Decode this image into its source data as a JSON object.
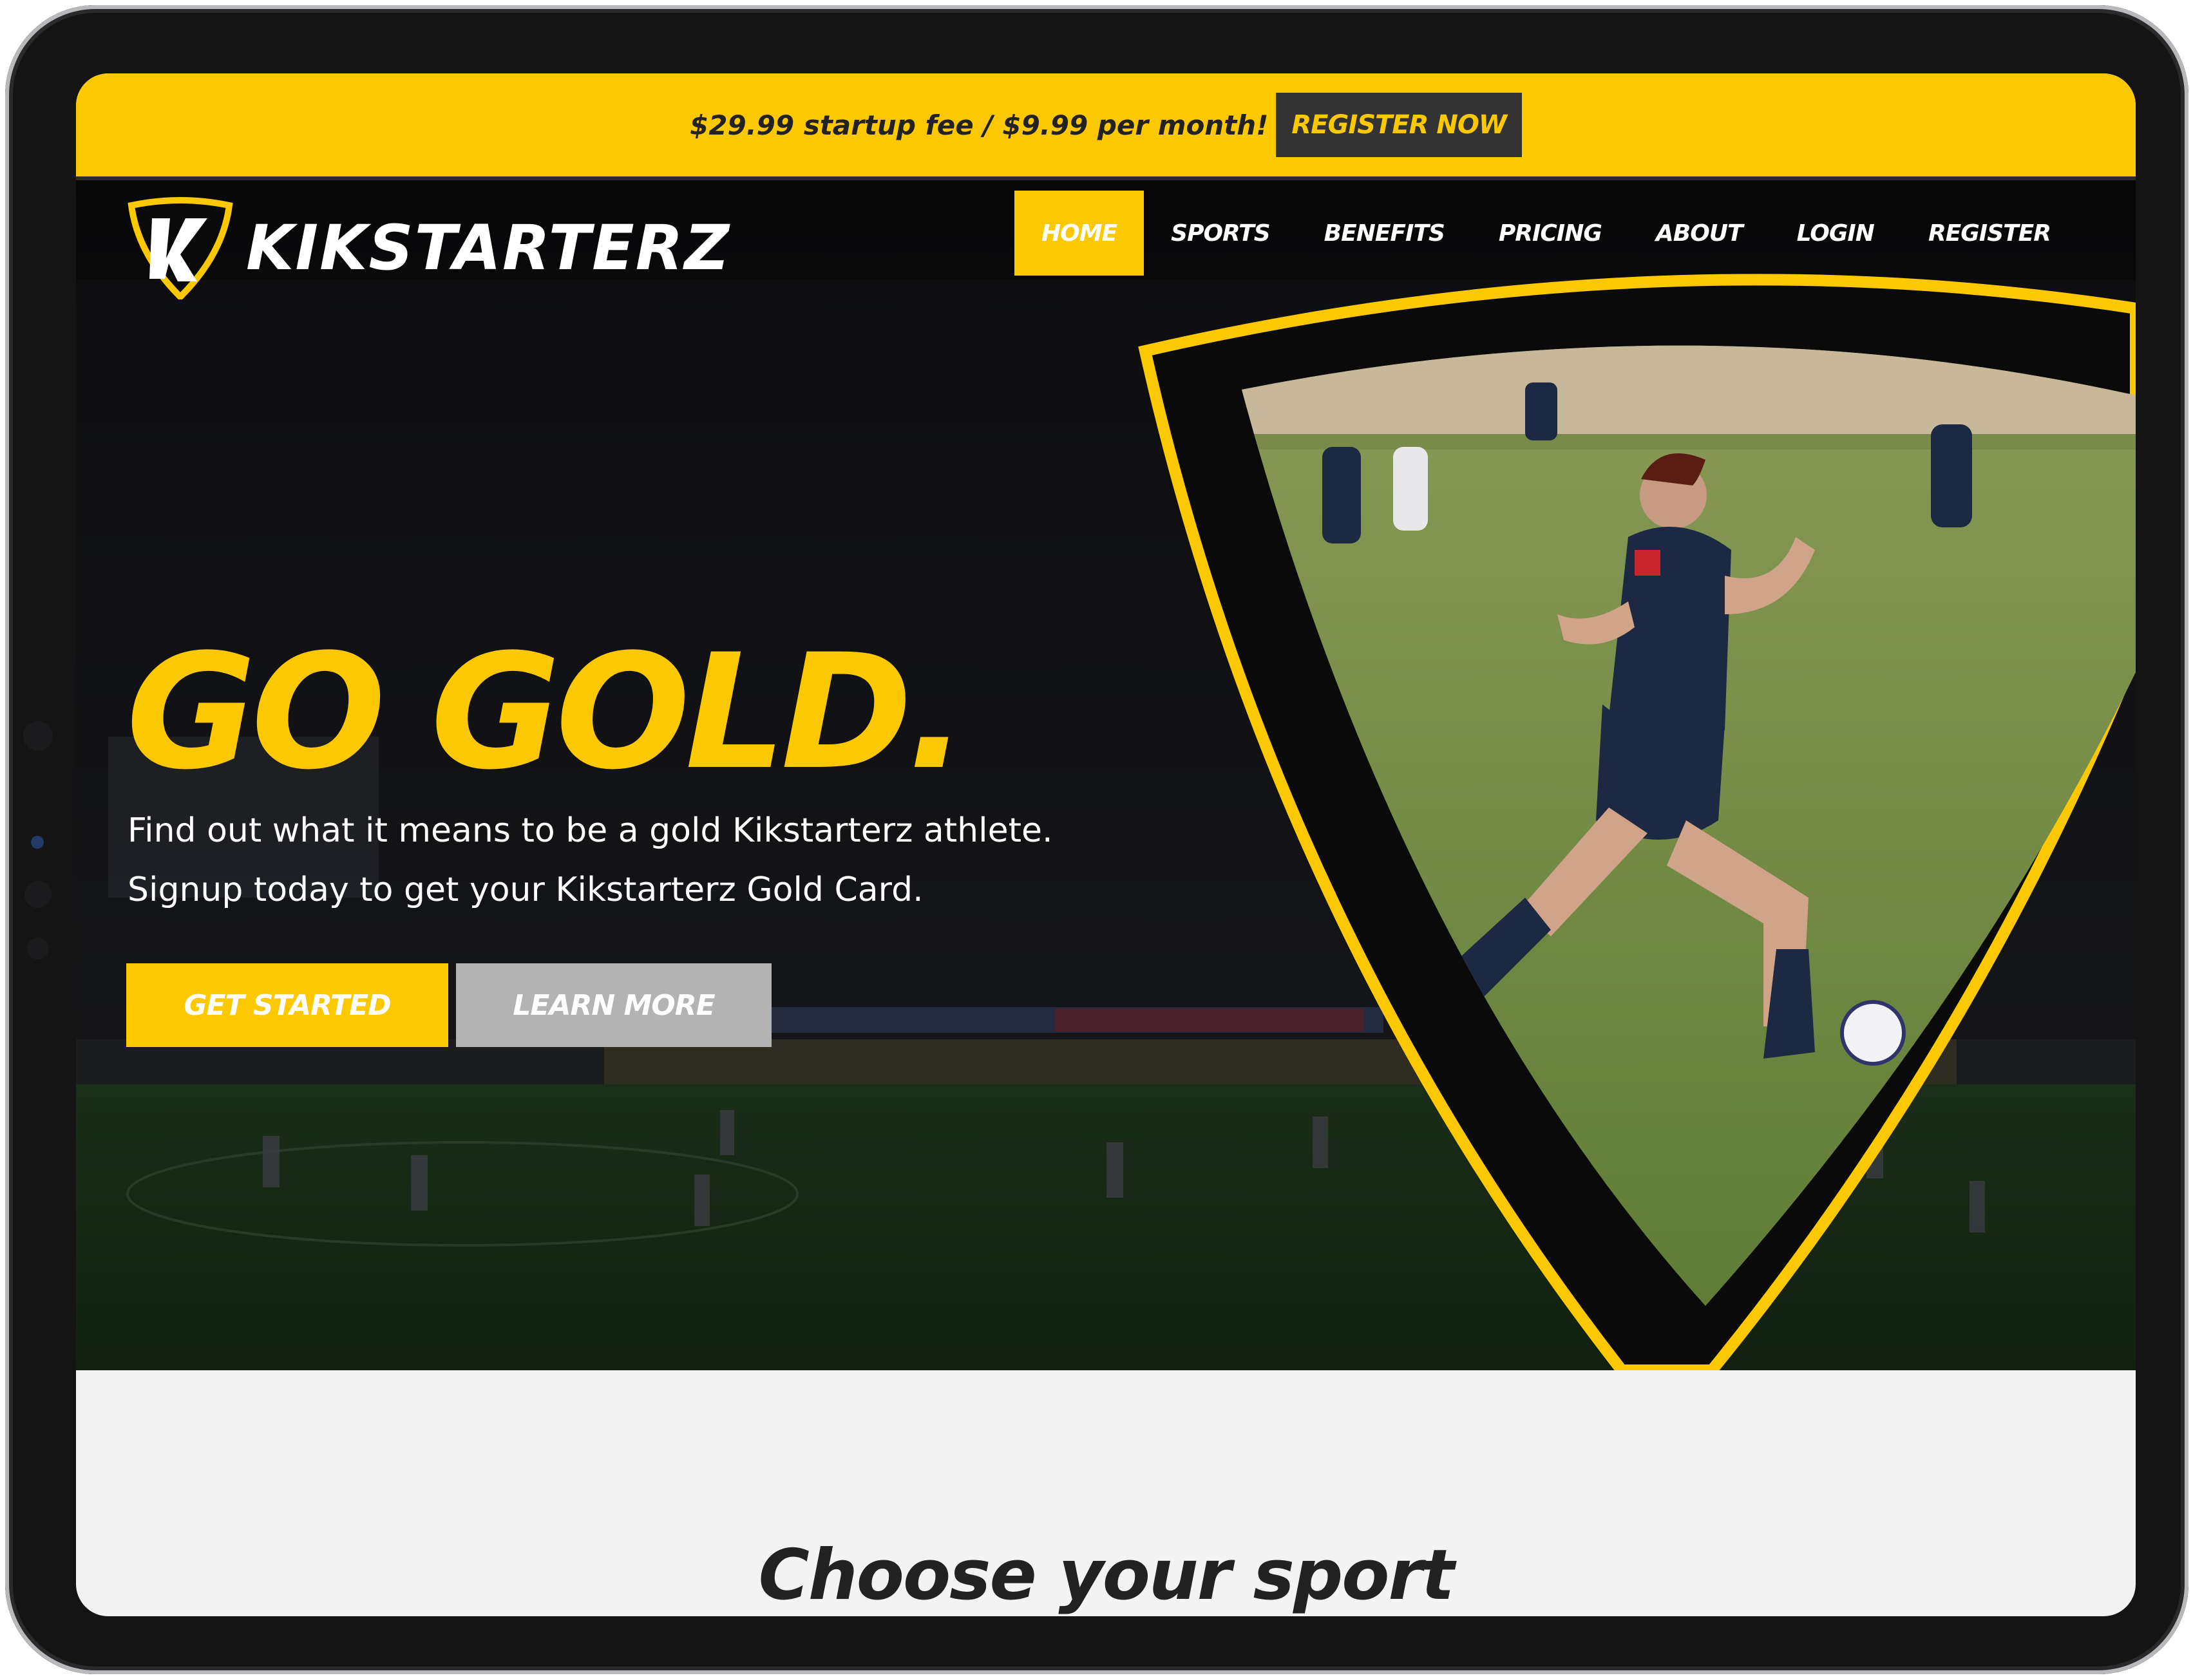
{
  "promo": {
    "text": "$29.99 startup fee / $9.99 per month!",
    "button": "REGISTER NOW"
  },
  "brand": {
    "name": "KIKSTARTERZ"
  },
  "nav": {
    "items": [
      {
        "label": "HOME",
        "active": true
      },
      {
        "label": "SPORTS"
      },
      {
        "label": "BENEFITS"
      },
      {
        "label": "PRICING"
      },
      {
        "label": "ABOUT"
      },
      {
        "label": "LOGIN"
      },
      {
        "label": "REGISTER"
      }
    ]
  },
  "hero": {
    "headline": "GO GOLD.",
    "sub_line1": "Find out what it means to be a gold Kikstarterz athlete.",
    "sub_line2": "Signup today to get your Kikstarterz Gold Card.",
    "primary_button": "GET STARTED",
    "secondary_button": "LEARN MORE"
  },
  "section": {
    "title": "Choose your sport"
  },
  "colors": {
    "brand_gold": "#fcc800",
    "dark": "#0a0a0b",
    "button_gray": "#b3b3b3",
    "promo_button": "#333333"
  },
  "icons": [
    "kikstarterz-logo-icon",
    "soccer-player-photo"
  ]
}
